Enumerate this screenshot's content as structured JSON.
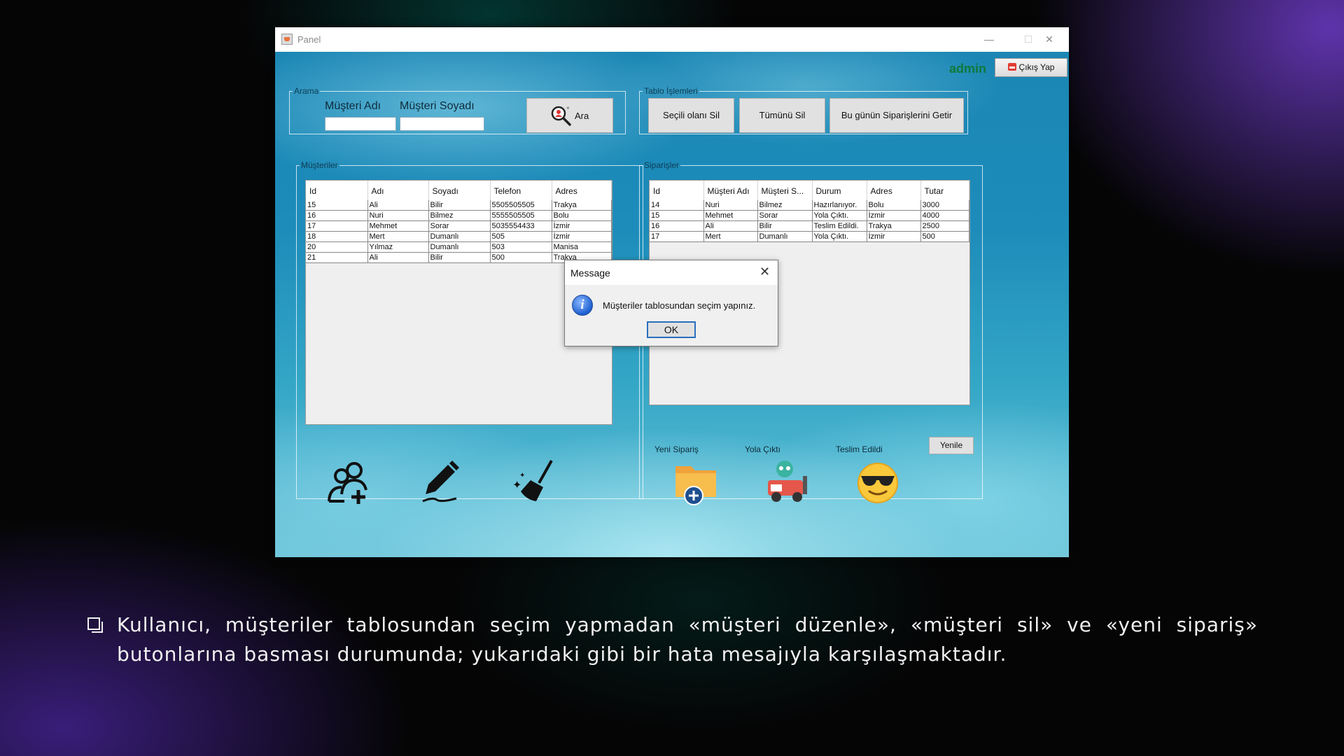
{
  "window": {
    "title": "Panel",
    "controls": {
      "minimize": "—",
      "maximize": "☐",
      "close": "✕"
    }
  },
  "header": {
    "user": "admin",
    "logout_label": "Çıkış Yap"
  },
  "search": {
    "legend": "Arama",
    "first_name_label": "Müşteri Adı",
    "last_name_label": "Müşteri Soyadı",
    "first_name_value": "",
    "last_name_value": "",
    "search_button": "Ara"
  },
  "table_ops": {
    "legend": "Tablo İşlemleri",
    "delete_selected": "Seçili olanı Sil",
    "delete_all": "Tümünü Sil",
    "today_orders": "Bu günün Siparişlerini Getir"
  },
  "customers": {
    "legend": "Müşteriler",
    "columns": [
      "Id",
      "Adı",
      "Soyadı",
      "Telefon",
      "Adres"
    ],
    "rows": [
      [
        "15",
        "Ali",
        "Bilir",
        "5505505505",
        "Trakya"
      ],
      [
        "16",
        "Nuri",
        "Bilmez",
        "5555505505",
        "Bolu"
      ],
      [
        "17",
        "Mehmet",
        "Sorar",
        "5035554433",
        "İzmir"
      ],
      [
        "18",
        "Mert",
        "Dumanlı",
        "505",
        "İzmir"
      ],
      [
        "20",
        "Yılmaz",
        "Dumanlı",
        "503",
        "Manisa"
      ],
      [
        "21",
        "Ali",
        "Bilir",
        "500",
        "Trakya"
      ]
    ]
  },
  "orders": {
    "legend": "Siparişler",
    "columns": [
      "Id",
      "Müşteri Adı",
      "Müşteri S...",
      "Durum",
      "Adres",
      "Tutar"
    ],
    "rows": [
      [
        "14",
        "Nuri",
        "Bilmez",
        "Hazırlanıyor.",
        "Bolu",
        "3000"
      ],
      [
        "15",
        "Mehmet",
        "Sorar",
        "Yola Çıktı.",
        "İzmir",
        "4000"
      ],
      [
        "16",
        "Ali",
        "Bilir",
        "Teslim Edildi.",
        "Trakya",
        "2500"
      ],
      [
        "17",
        "Mert",
        "Dumanlı",
        "Yola Çıktı.",
        "İzmir",
        "500"
      ]
    ],
    "new_order_label": "Yeni Sipariş",
    "shipped_label": "Yola Çıktı",
    "delivered_label": "Teslim Edildi",
    "refresh_button": "Yenile"
  },
  "dialog": {
    "title": "Message",
    "message": "Müşteriler tablosundan seçim yapınız.",
    "ok": "OK",
    "close": "✕"
  },
  "slide": {
    "caption": "Kullanıcı, müşteriler tablosundan seçim yapmadan «müşteri düzenle», «müşteri sil» ve «yeni sipariş» butonlarına basması durumunda; yukarıdaki gibi bir hata mesajıyla karşılaşmaktadır."
  },
  "icons": {
    "add_customer": "add-user-icon",
    "edit_customer": "pencil-icon",
    "clear": "broom-icon",
    "new_order": "folder-plus-icon",
    "shipped": "delivery-robot-icon",
    "delivered": "sunglasses-smiley-icon",
    "search": "magnifier-icon",
    "logout": "calendar-icon",
    "info": "info-icon"
  }
}
